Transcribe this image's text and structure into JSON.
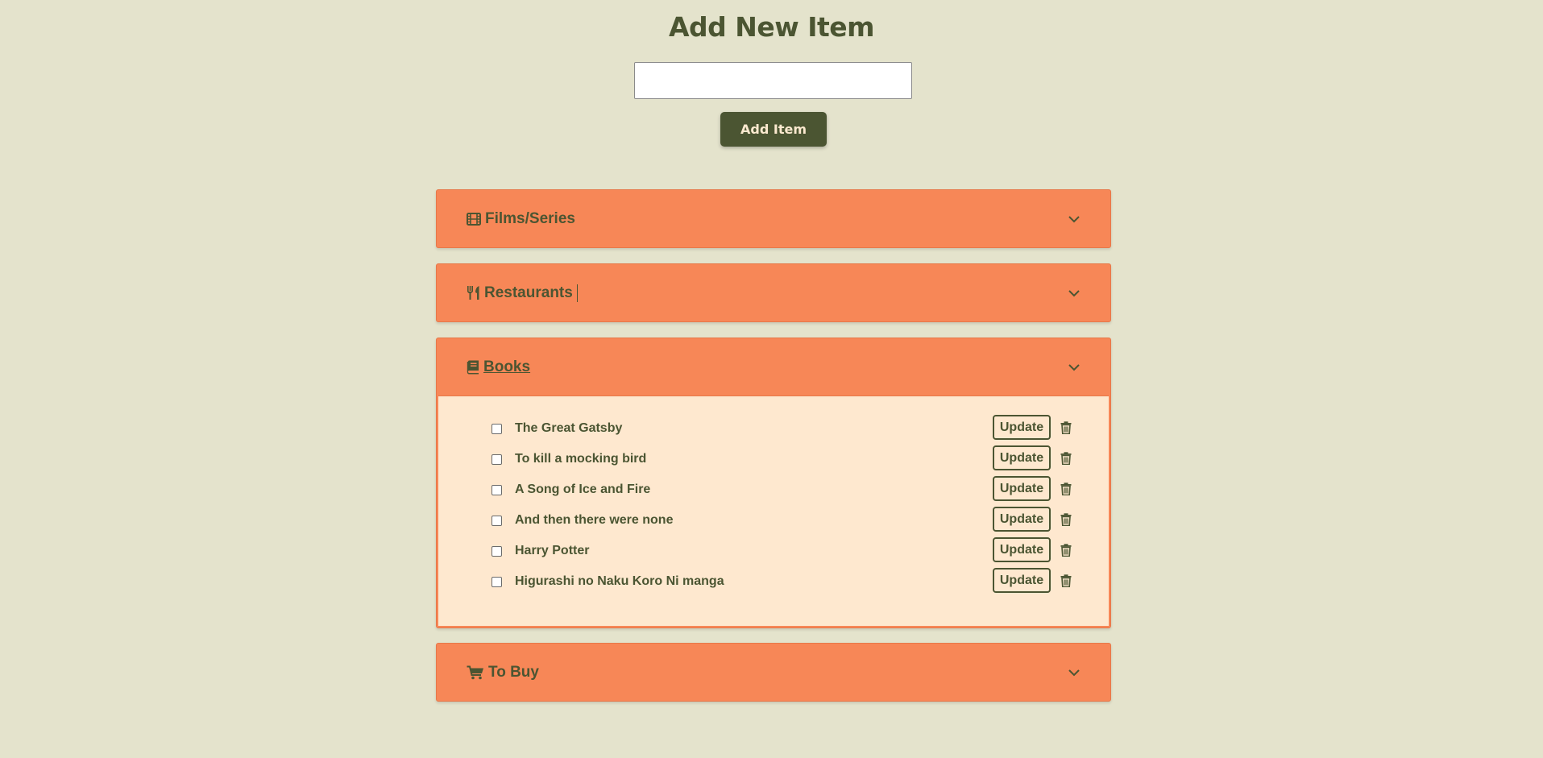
{
  "header": {
    "title": "Add New Item"
  },
  "form": {
    "input_value": "",
    "input_placeholder": "",
    "add_label": "Add Item"
  },
  "colors": {
    "background": "#e4e3cc",
    "accent_dark": "#4b5532",
    "accordion": "#f78757",
    "panel": "#fee8cf"
  },
  "categories": [
    {
      "label": "Films/Series",
      "icon": "film-icon",
      "expanded": false
    },
    {
      "label": "Restaurants",
      "icon": "utensils-icon",
      "expanded": false
    },
    {
      "label": "Books",
      "icon": "book-icon",
      "expanded": true
    },
    {
      "label": "To Buy",
      "icon": "cart-icon",
      "expanded": false
    }
  ],
  "books": {
    "update_label": "Update",
    "items": [
      {
        "text": "The Great Gatsby",
        "checked": false
      },
      {
        "text": "To kill a mocking bird",
        "checked": false
      },
      {
        "text": "A Song of Ice and Fire",
        "checked": false
      },
      {
        "text": "And then there were none",
        "checked": false
      },
      {
        "text": "Harry Potter",
        "checked": false
      },
      {
        "text": "Higurashi no Naku Koro Ni manga",
        "checked": false
      }
    ]
  }
}
